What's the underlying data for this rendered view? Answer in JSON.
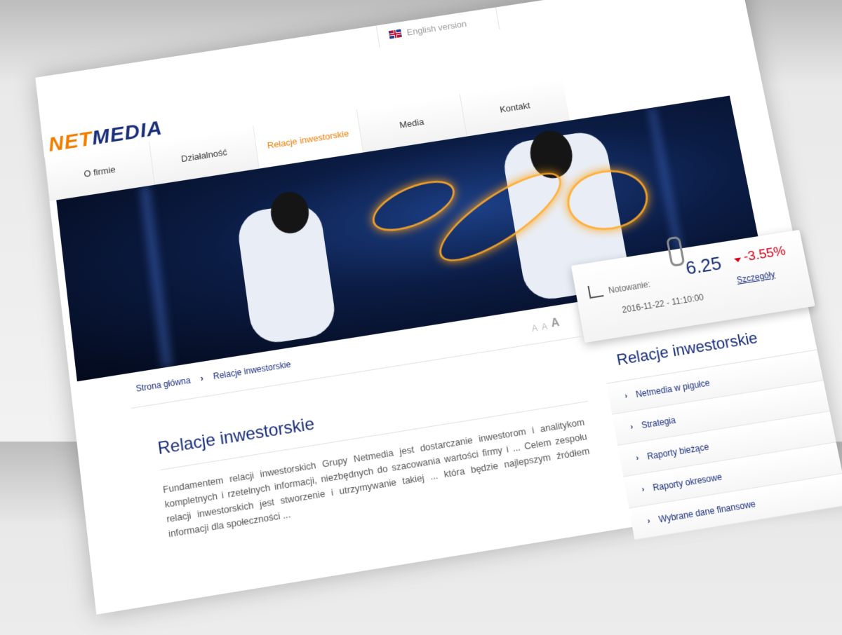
{
  "header": {
    "language_label": "English version",
    "logo_part1": "NET",
    "logo_part2": "MEDIA"
  },
  "nav": {
    "items": [
      {
        "label": "O firmie"
      },
      {
        "label": "Działalność"
      },
      {
        "label": "Relacje inwestorskie"
      },
      {
        "label": "Media"
      },
      {
        "label": "Kontakt"
      }
    ]
  },
  "quote": {
    "label": "Notowanie:",
    "price": "6.25",
    "change": "-3.55%",
    "date": "2016-11-22 - 11:10:00",
    "details_link": "Szczegóły"
  },
  "breadcrumb": {
    "home": "Strona główna",
    "current": "Relacje inwestorskie"
  },
  "font_size_controls": [
    "A",
    "A",
    "A"
  ],
  "main": {
    "title": "Relacje inwestorskie",
    "text": "Fundamentem relacji inwestorskich Grupy Netmedia jest dostarczanie inwestorom i analitykom kompletnych i rzetelnych informacji, niezbędnych do szacowania wartości firmy i ... Celem zespołu relacji inwestorskich jest stworzenie i utrzymywanie takiej ... która będzie najlepszym źródłem informacji dla społeczności ..."
  },
  "sidebar": {
    "title": "Relacje inwestorskie",
    "items": [
      {
        "label": "Netmedia w pigułce"
      },
      {
        "label": "Strategia"
      },
      {
        "label": "Raporty bieżące"
      },
      {
        "label": "Raporty okresowe"
      },
      {
        "label": "Wybrane dane finansowe"
      }
    ]
  },
  "colors": {
    "brand_orange": "#f07d00",
    "brand_navy": "#1a2e78",
    "negative": "#d0021b"
  }
}
